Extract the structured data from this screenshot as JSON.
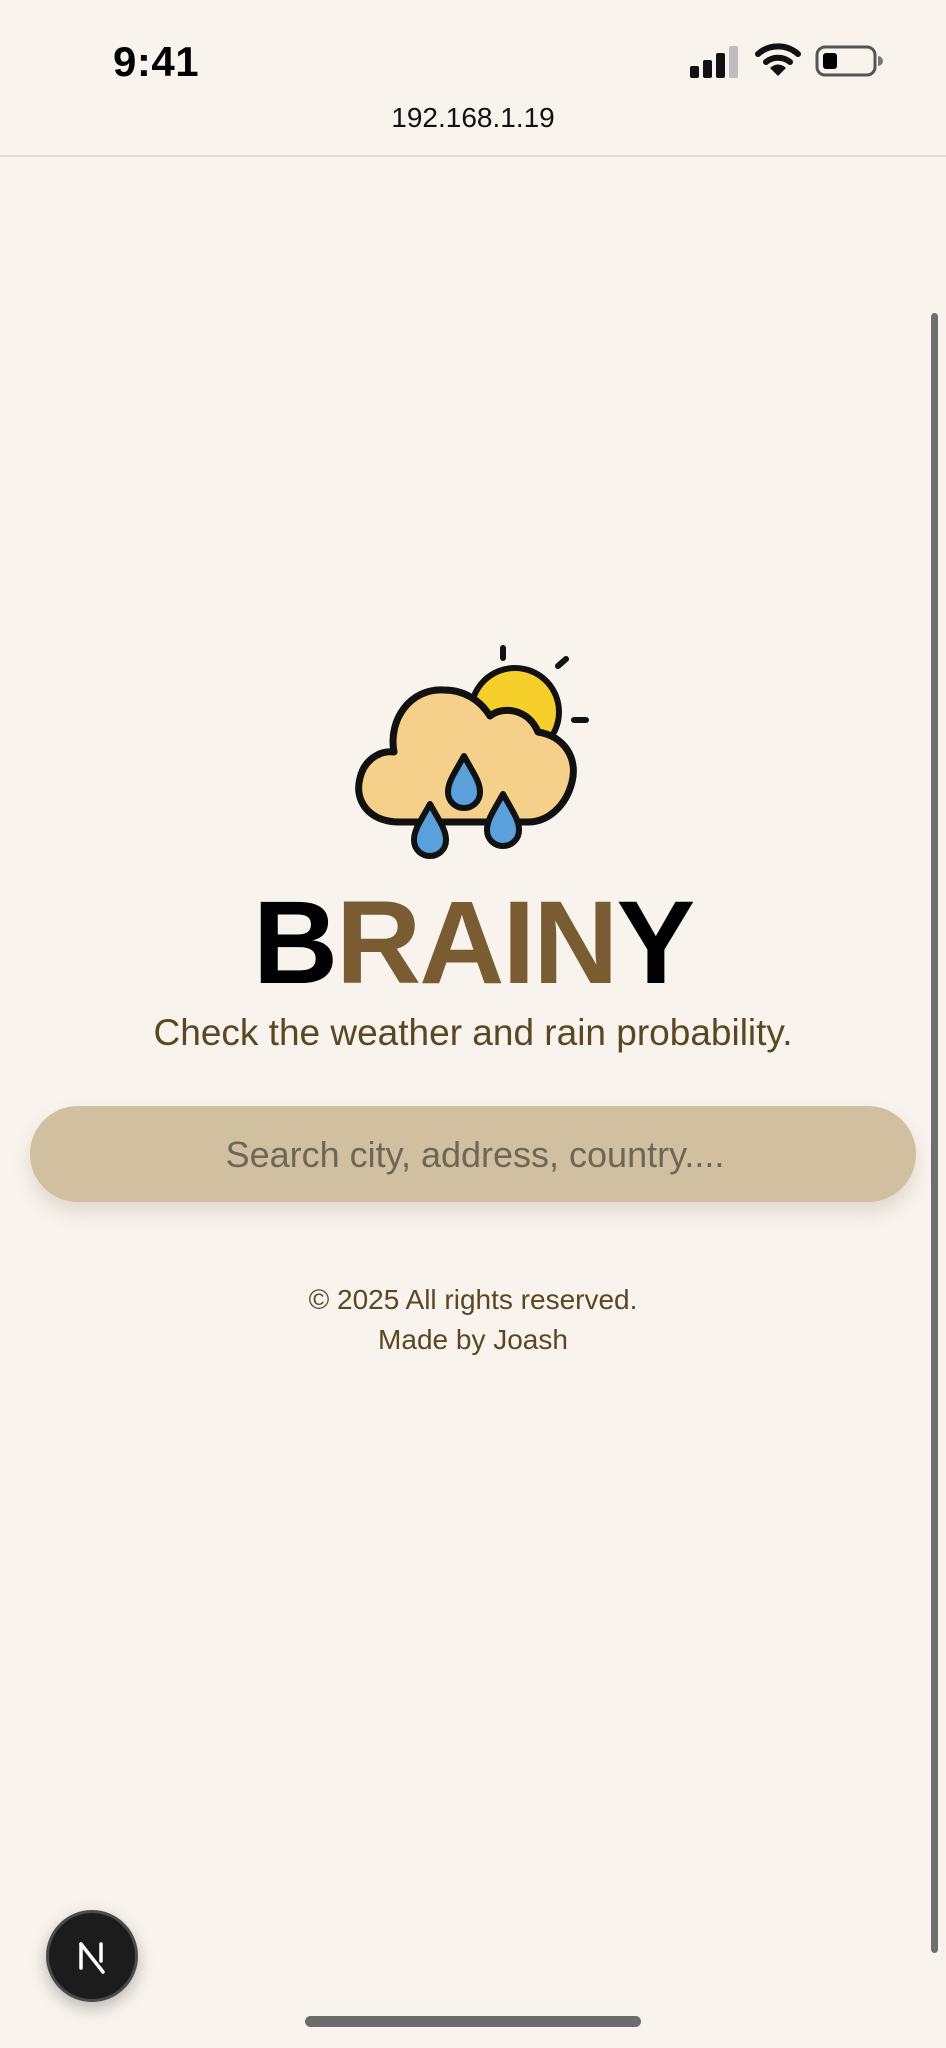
{
  "status_bar": {
    "time": "9:41",
    "signal_icon": "cellular-signal-icon",
    "wifi_icon": "wifi-icon",
    "battery_icon": "battery-icon",
    "battery_level": 0.25
  },
  "browser": {
    "url": "192.168.1.19"
  },
  "hero": {
    "logo_icon": "sun-cloud-rain-icon",
    "brand_prefix": "B",
    "brand_middle": "RAIN",
    "brand_suffix": "Y",
    "tagline": "Check the weather and rain probability."
  },
  "search": {
    "placeholder": "Search city, address, country....",
    "value": ""
  },
  "footer": {
    "copyright": "© 2025 All rights reserved.",
    "credit": "Made by Joash"
  },
  "dev_badge": {
    "label": "N",
    "icon": "nextjs-icon"
  },
  "colors": {
    "background": "#f8f3ed",
    "brand_gold": "#7a5c33",
    "tagline": "#5b4721",
    "search_bg": "#d1c09f",
    "cloud": "#f4d08a",
    "sun": "#f7cf2b",
    "raindrop": "#5aa0dc"
  }
}
